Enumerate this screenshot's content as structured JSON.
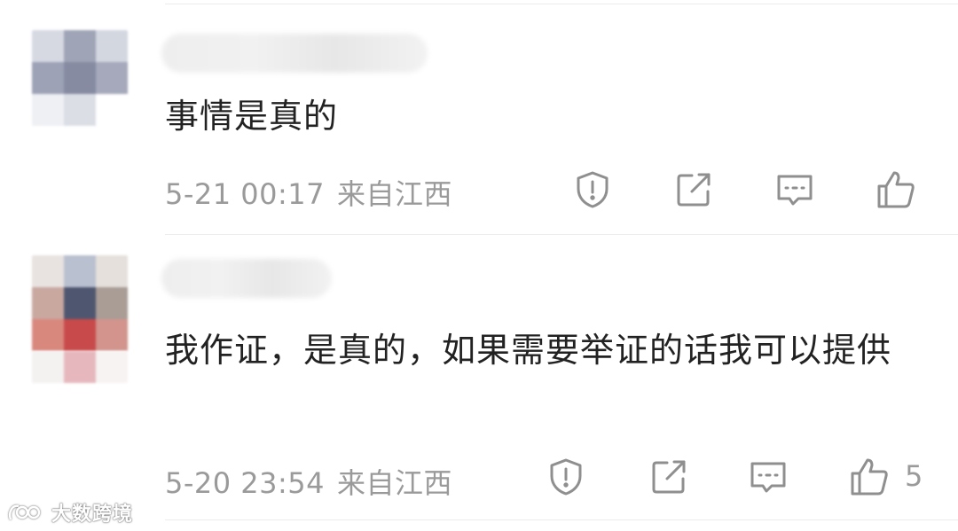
{
  "comments": [
    {
      "text": "事情是真的",
      "time": "5-21 00:17",
      "location": "来自江西",
      "like_count": ""
    },
    {
      "text": "我作证，是真的，如果需要举证的话我可以提供",
      "time": "5-20 23:54",
      "location": "来自江西",
      "like_count": "5"
    }
  ],
  "icons": {
    "report": "shield-exclamation-icon",
    "share": "share-external-icon",
    "reply": "comment-bubble-icon",
    "like": "thumbs-up-icon"
  },
  "watermark": {
    "text": "大数跨境"
  },
  "colors": {
    "text": "#222222",
    "meta": "#9a9a9a",
    "icon": "#8f8f8f",
    "divider": "#ececec"
  }
}
